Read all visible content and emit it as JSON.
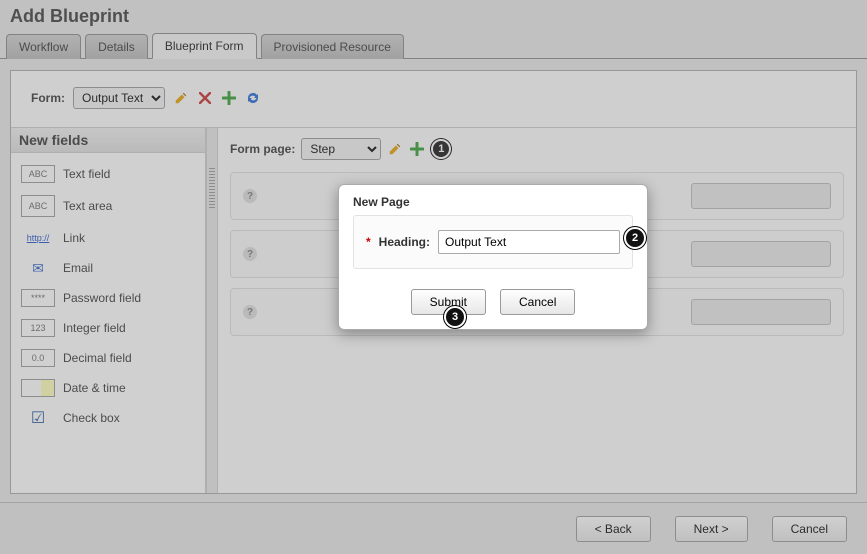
{
  "page_title": "Add Blueprint",
  "tabs": [
    {
      "id": "workflow",
      "label": "Workflow"
    },
    {
      "id": "details",
      "label": "Details"
    },
    {
      "id": "blueprint-form",
      "label": "Blueprint Form"
    },
    {
      "id": "provisioned-resource",
      "label": "Provisioned Resource"
    }
  ],
  "active_tab": "Blueprint Form",
  "form_selector": {
    "label": "Form:",
    "selected": "Output Text"
  },
  "form_page": {
    "label": "Form page:",
    "selected": "Step"
  },
  "markers": {
    "one": "1",
    "two": "2",
    "three": "3"
  },
  "left_panel": {
    "title": "New fields",
    "items": [
      {
        "key": "text-field",
        "label": "Text field",
        "box": "ABC"
      },
      {
        "key": "text-area",
        "label": "Text area",
        "box": "ABC"
      },
      {
        "key": "link",
        "label": "Link",
        "box": "http://"
      },
      {
        "key": "email",
        "label": "Email",
        "box": "✉"
      },
      {
        "key": "password-field",
        "label": "Password field",
        "box": "****"
      },
      {
        "key": "integer-field",
        "label": "Integer field",
        "box": "123"
      },
      {
        "key": "decimal-field",
        "label": "Decimal field",
        "box": "0.0"
      },
      {
        "key": "date-time",
        "label": "Date & time",
        "box": ""
      },
      {
        "key": "check-box",
        "label": "Check box",
        "box": "☑"
      }
    ]
  },
  "modal": {
    "title": "New Page",
    "heading_label": "Heading:",
    "heading_value": "Output Text",
    "submit": "Submit",
    "cancel": "Cancel"
  },
  "footer": {
    "back": "< Back",
    "next": "Next >",
    "cancel": "Cancel"
  }
}
